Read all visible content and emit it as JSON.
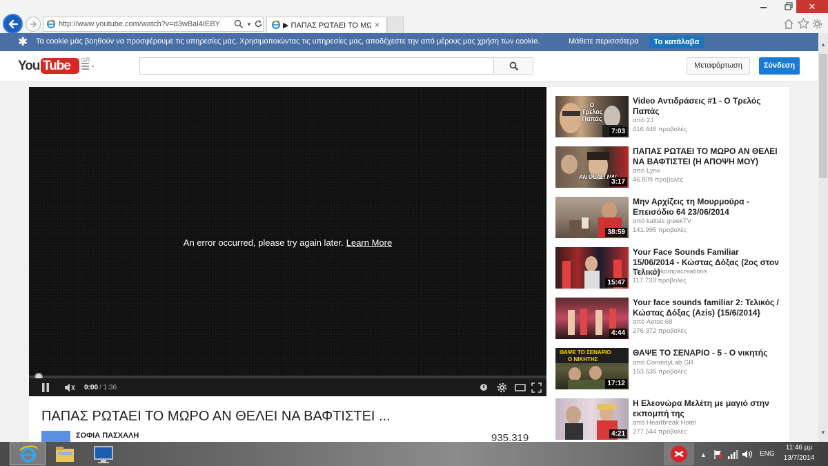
{
  "browser": {
    "url": "http://www.youtube.com/watch?v=d3wBal4IEBY",
    "tab_title": "▶ ΠΑΠΑΣ ΡΩΤΑΕΙ ΤΟ ΜΩΡΟ...",
    "tab_close": "×",
    "close_glyph": "✕"
  },
  "cookie": {
    "icon": "✱",
    "text": "Τα cookie μάς βοηθούν να προσφέρουμε τις υπηρεσίες μας. Χρησιμοποιώντας τις υπηρεσίες μας, αποδέχεστε την από μέρους μας χρήση των cookie.",
    "learn_more": "Μάθετε περισσότερα",
    "ok_button": "Το κατάλαβα"
  },
  "header": {
    "logo_you": "You",
    "logo_tube": "Tube",
    "logo_region": "GR",
    "search_placeholder": "",
    "upload_button": "Μεταφόρτωση",
    "signin_button": "Σύνδεση"
  },
  "player": {
    "error_text": "An error occurred, please try again later.",
    "learn_more": "Learn More",
    "time_current": "0:00",
    "time_total": "/ 1:36",
    "progress": 0
  },
  "video": {
    "title": "ΠΑΠΑΣ ΡΩΤΑΕΙ ΤΟ ΜΩΡΟ ΑΝ ΘΕΛΕΙ ΝΑ ΒΑΦΤΙΣΤΕΙ ...",
    "channel": "ΣΟΦΙΑ ΠΑΣΧΑΛΗ",
    "views": "935.319"
  },
  "related": [
    {
      "title": "Video Αντιδράσεις #1 - Ο Τρελός Παπάς",
      "channel": "από 2J",
      "views": "416.446 προβολές",
      "duration": "7:03"
    },
    {
      "title": "ΠΑΠΑΣ ΡΩΤΑΕΙ ΤΟ ΜΩΡΟ ΑΝ ΘΕΛΕΙ ΝΑ ΒΑΦΤΙΣΤΕΙ (Η ΑΠΟΨΗ ΜΟΥ)",
      "channel": "από Lynx",
      "views": "46.809 προβολές",
      "duration": "3:17"
    },
    {
      "title": "Μην Αρχίζεις τη Μουρμούρα - Επεισόδιο 64 23/06/2014",
      "channel": "από kaltsis greekTV",
      "views": "141.995 προβολές",
      "duration": "38:59"
    },
    {
      "title": "Your Face Sounds Familiar 15/06/2014 - Κώστας Δόξας (2ος στον Τελικό)",
      "channel": "από nosokompacreations",
      "views": "117.733 προβολές",
      "duration": "15:47"
    },
    {
      "title": "Your face sounds familiar 2: Τελικός / Κώστας Δόξας (Azis) {15/6/2014}",
      "channel": "από Aetos 68",
      "views": "276.372 προβολές",
      "duration": "4:44"
    },
    {
      "title": "ΘΑΨΕ ΤΟ ΣΕΝΑΡΙΟ - 5 - Ο νικητής",
      "channel": "από ComedyLab GR",
      "views": "153.535 προβολές",
      "duration": "17:12"
    },
    {
      "title": "Η Ελεονώρα Μελέτη με μαγιό στην εκπομπή της",
      "channel": "από Heartbreak Hotel",
      "views": "277.544 προβολές",
      "duration": "4:21"
    }
  ],
  "thumb_text": {
    "t1": "Ο Τρελός Παπάς",
    "t2": "ΑΝ ΘΕΛΕΙ ΝΑ!",
    "t6a": "ΘΑΨΕ ΤΟ ΣΕΝΑΡΙΟ",
    "t6b": "Ο ΝΙΚΗΤΗΣ"
  },
  "taskbar": {
    "lang": "ENG",
    "time": "11:46 μμ",
    "date": "13/7/2014"
  },
  "colors": {
    "cookie_bar": "#4a6fa5",
    "yt_red": "#d92724",
    "signin_blue": "#1b7ad3",
    "player_bg": "#121212"
  }
}
